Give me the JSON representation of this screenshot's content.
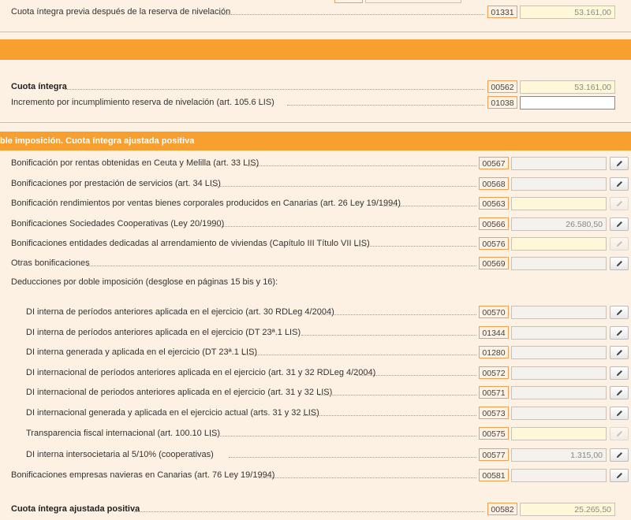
{
  "top_section": {
    "rows": [
      {
        "label": "Cuota íntegra previa después de la reserva de nivelación",
        "code": "01331",
        "value": "53.161,00"
      }
    ]
  },
  "quota_section": {
    "title": "",
    "rows": [
      {
        "label": "Cuota íntegra",
        "code": "00562",
        "value": "53.161,00"
      },
      {
        "label": "Incremento por incumplimiento reserva de nivelación (art. 105.6 LIS)",
        "code": "01038",
        "value": ""
      }
    ]
  },
  "bonif_section": {
    "title": "ble imposición. Cuota íntegra ajustada positiva",
    "rows": [
      {
        "label": "Bonificación por rentas obtenidas en Ceuta y Melilla (art. 33 LIS)",
        "code": "00567",
        "value": ""
      },
      {
        "label": "Bonificaciones por prestación de servicios (art. 34 LIS)",
        "code": "00568",
        "value": ""
      },
      {
        "label": "Bonificación rendimientos por ventas bienes corporales producidos en Canarias (art. 26 Ley 19/1994)",
        "code": "00563",
        "value": ""
      },
      {
        "label": "Bonificaciones Sociedades Cooperativas (Ley 20/1990)",
        "code": "00566",
        "value": "26.580,50"
      },
      {
        "label": "Bonificaciones entidades dedicadas al arrendamiento de viviendas (Capítulo III Título VII LIS)",
        "code": "00576",
        "value": ""
      },
      {
        "label": "Otras bonificaciones",
        "code": "00569",
        "value": ""
      }
    ],
    "deductions_heading": "Deducciones por doble imposición (desglose en páginas 15 bis y 16):",
    "deductions": [
      {
        "label": "DI interna de períodos anteriores aplicada en el ejercicio (art. 30 RDLeg 4/2004)",
        "code": "00570",
        "value": ""
      },
      {
        "label": "DI interna de períodos anteriores aplicada en el ejercicio (DT 23ª.1 LIS)",
        "code": "01344",
        "value": ""
      },
      {
        "label": "DI interna generada y aplicada en el ejercicio (DT 23ª.1 LIS)",
        "code": "01280",
        "value": ""
      },
      {
        "label": "DI internacional de períodos anteriores aplicada en el ejercicio (art. 31 y 32 RDLeg 4/2004)",
        "code": "00572",
        "value": ""
      },
      {
        "label": "DI internacional de periodos anteriores aplicada en el ejercicio (art. 31 y 32 LIS)",
        "code": "00571",
        "value": ""
      },
      {
        "label": "DI internacional generada y aplicada en el ejercicio actual (arts. 31 y 32 LIS)",
        "code": "00573",
        "value": ""
      },
      {
        "label": "Transparencia fiscal internacional (art. 100.10 LIS)",
        "code": "00575",
        "value": ""
      },
      {
        "label": "DI interna intersocietaria al 5/10% (cooperativas)",
        "code": "00577",
        "value": "1.315,00"
      }
    ],
    "after_rows": [
      {
        "label": "Bonificaciones empresas navieras en Canarias (art. 76 Ley 19/1994)",
        "code": "00581",
        "value": ""
      }
    ],
    "final_row": {
      "label": "Cuota íntegra ajustada positiva",
      "code": "00582",
      "value": "25.265,50"
    }
  },
  "icons": {
    "edit": "pencil-icon"
  },
  "colors": {
    "section_bar": "#f7a030",
    "code_border": "#f0a050",
    "background": "#fdf1e3",
    "readonly_field": "#fff8d8"
  }
}
